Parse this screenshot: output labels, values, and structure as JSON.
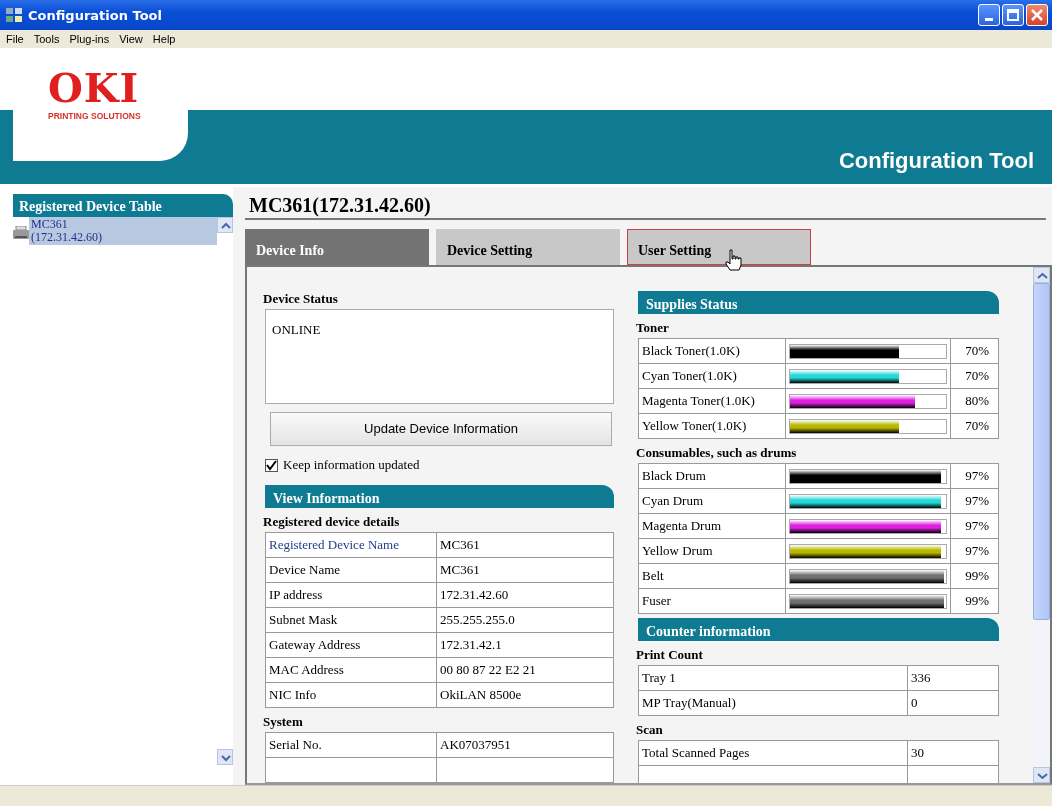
{
  "window": {
    "title": "Configuration Tool"
  },
  "menu": [
    "File",
    "Tools",
    "Plug-ins",
    "View",
    "Help"
  ],
  "header": {
    "logo": "OKI",
    "tagline": "PRINTING SOLUTIONS",
    "title": "Configuration Tool"
  },
  "sidebar": {
    "title": "Registered Device Table",
    "devices": [
      {
        "name": "MC361",
        "address": "(172.31.42.60)",
        "selected": true
      }
    ]
  },
  "device_title": "MC361(172.31.42.60)",
  "tabs": [
    {
      "label": "Device Info",
      "selected": true,
      "hover": false
    },
    {
      "label": "Device Setting",
      "selected": false,
      "hover": false
    },
    {
      "label": "User Setting",
      "selected": false,
      "hover": true
    }
  ],
  "device_status": {
    "label": "Device Status",
    "value": "ONLINE"
  },
  "update_button": "Update Device Information",
  "keep_updated": {
    "label": "Keep information updated",
    "checked": true
  },
  "view_information": {
    "title": "View Information",
    "sections": [
      {
        "title": "Registered device details",
        "rows": [
          {
            "name": "Registered Device Name",
            "value": "MC361",
            "link": true
          },
          {
            "name": "Device Name",
            "value": "MC361",
            "link": false
          },
          {
            "name": "IP address",
            "value": "172.31.42.60",
            "link": false
          },
          {
            "name": "Subnet Mask",
            "value": "255.255.255.0",
            "link": false
          },
          {
            "name": "Gateway Address",
            "value": "172.31.42.1",
            "link": false
          },
          {
            "name": "MAC Address",
            "value": "00 80 87 22 E2 21",
            "link": false
          },
          {
            "name": "NIC Info",
            "value": "OkiLAN 8500e",
            "link": false
          }
        ]
      },
      {
        "title": "System",
        "rows": [
          {
            "name": "Serial No.",
            "value": "AK07037951",
            "link": false
          }
        ]
      }
    ]
  },
  "supplies": {
    "title": "Supplies Status",
    "groups": [
      {
        "title": "Toner",
        "items": [
          {
            "name": "Black Toner(1.0K)",
            "level": 0.7,
            "reading": "70%",
            "color": "#000000"
          },
          {
            "name": "Cyan Toner(1.0K)",
            "level": 0.7,
            "reading": "70%",
            "color": "#22d8d8"
          },
          {
            "name": "Magenta Toner(1.0K)",
            "level": 0.8,
            "reading": "80%",
            "color": "#e020e0"
          },
          {
            "name": "Yellow Toner(1.0K)",
            "level": 0.7,
            "reading": "70%",
            "color": "#b8b800"
          }
        ]
      },
      {
        "title": "Consumables, such as drums",
        "items": [
          {
            "name": "Black Drum",
            "level": 0.97,
            "reading": "97%",
            "color": "#000000"
          },
          {
            "name": "Cyan Drum",
            "level": 0.97,
            "reading": "97%",
            "color": "#22d8d8"
          },
          {
            "name": "Magenta Drum",
            "level": 0.97,
            "reading": "97%",
            "color": "#e020e0"
          },
          {
            "name": "Yellow Drum",
            "level": 0.97,
            "reading": "97%",
            "color": "#b8b800"
          },
          {
            "name": "Belt",
            "level": 0.99,
            "reading": "99%",
            "color": "#707070"
          },
          {
            "name": "Fuser",
            "level": 0.99,
            "reading": "99%",
            "color": "#707070"
          }
        ]
      }
    ]
  },
  "counters": {
    "title": "Counter information",
    "sections": [
      {
        "title": "Print Count",
        "rows": [
          {
            "name": "Tray 1",
            "value": "336"
          },
          {
            "name": "MP Tray(Manual)",
            "value": "0"
          }
        ]
      },
      {
        "title": "Scan",
        "rows": [
          {
            "name": "Total Scanned Pages",
            "value": "30"
          }
        ]
      }
    ]
  }
}
